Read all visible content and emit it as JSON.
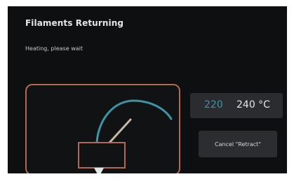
{
  "dialog": {
    "title": "Filaments Returning",
    "subtitle": "Heating, please wait"
  },
  "temperature": {
    "current": "220",
    "target": "240 °C"
  },
  "actions": {
    "cancel_label": "Cancel \"Retract\""
  },
  "colors": {
    "accent": "#3d94a6",
    "frame": "#b06a4e",
    "background": "#0e0f11",
    "panel": "#2a2c30"
  },
  "icons": {
    "illustration": "nozzle-retract-icon"
  }
}
